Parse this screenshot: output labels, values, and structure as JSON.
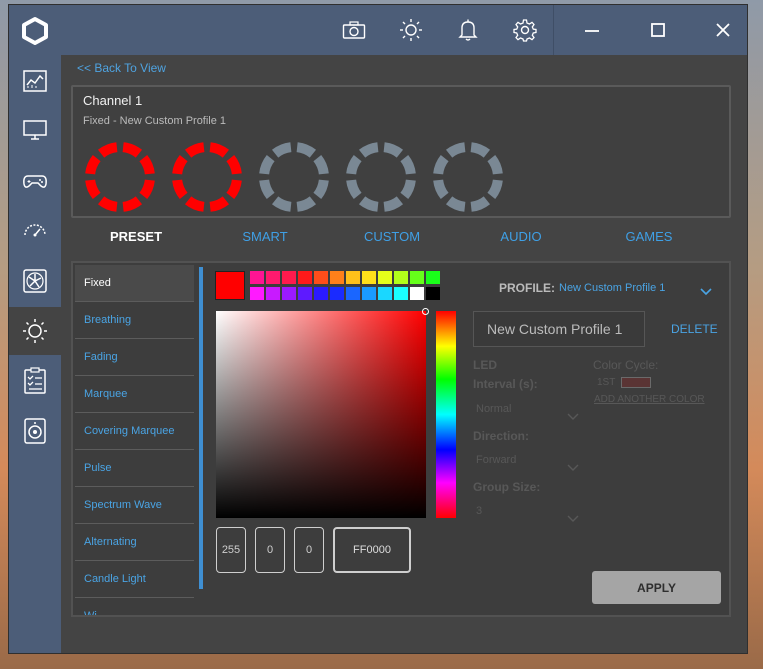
{
  "colors": {
    "accent": "#4aa4e4",
    "sidebar": "#4c5d78",
    "led_on": "#ff0000",
    "led_off": "#7a8894"
  },
  "sidebar": {
    "items": [
      {
        "icon": "dashboard-icon"
      },
      {
        "icon": "monitor-icon"
      },
      {
        "icon": "gamepad-icon"
      },
      {
        "icon": "gauge-icon"
      },
      {
        "icon": "fan-icon"
      },
      {
        "icon": "lighting-icon"
      },
      {
        "icon": "checklist-icon"
      },
      {
        "icon": "speaker-icon"
      }
    ],
    "active_index": 5
  },
  "topbar": {
    "icons": [
      "camera-icon",
      "brightness-icon",
      "bell-icon",
      "gear-icon",
      "minimize-icon",
      "maximize-icon",
      "close-icon"
    ]
  },
  "back_link": "<< Back To View",
  "channel": {
    "title": "Channel 1",
    "subtitle": "Fixed - New Custom Profile 1",
    "leds": [
      "on",
      "on",
      "off",
      "off",
      "off"
    ]
  },
  "tabs": [
    {
      "label": "PRESET",
      "active": true
    },
    {
      "label": "SMART",
      "active": false
    },
    {
      "label": "CUSTOM",
      "active": false
    },
    {
      "label": "AUDIO",
      "active": false
    },
    {
      "label": "GAMES",
      "active": false
    }
  ],
  "modes": [
    "Fixed",
    "Breathing",
    "Fading",
    "Marquee",
    "Covering Marquee",
    "Pulse",
    "Spectrum Wave",
    "Alternating",
    "Candle Light",
    "Wi"
  ],
  "active_mode": 0,
  "color_picker": {
    "selected_hex": "#FF0000",
    "swatch_row1": [
      "#ff1493",
      "#ff1a6e",
      "#ff1a4d",
      "#ff1a1a",
      "#ff4d1a",
      "#ff801a",
      "#ffc01a",
      "#ffe01a",
      "#e6ff1a",
      "#b3ff1a",
      "#66ff1a",
      "#1aff1a"
    ],
    "swatch_row2": [
      "#ff1aff",
      "#c81aff",
      "#9b1aff",
      "#5e1aff",
      "#2b1aff",
      "#1a2bff",
      "#1a66ff",
      "#1a9bff",
      "#1ad7ff",
      "#1affff",
      "#ffffff",
      "#000000"
    ],
    "r": "255",
    "g": "0",
    "b": "0",
    "hex": "FF0000"
  },
  "profile": {
    "label": "PROFILE:",
    "value": "New Custom Profile 1",
    "name_field": "New Custom Profile 1",
    "delete_label": "DELETE"
  },
  "settings": {
    "led_interval_label_1": "LED",
    "led_interval_label_2": "Interval (s):",
    "led_interval_value": "Normal",
    "direction_label": "Direction:",
    "direction_value": "Forward",
    "group_size_label": "Group Size:",
    "group_size_value": "3",
    "color_cycle_label": "Color Cycle:",
    "color_cycle_item": "1ST",
    "add_color_label": "ADD ANOTHER COLOR"
  },
  "apply_label": "APPLY"
}
